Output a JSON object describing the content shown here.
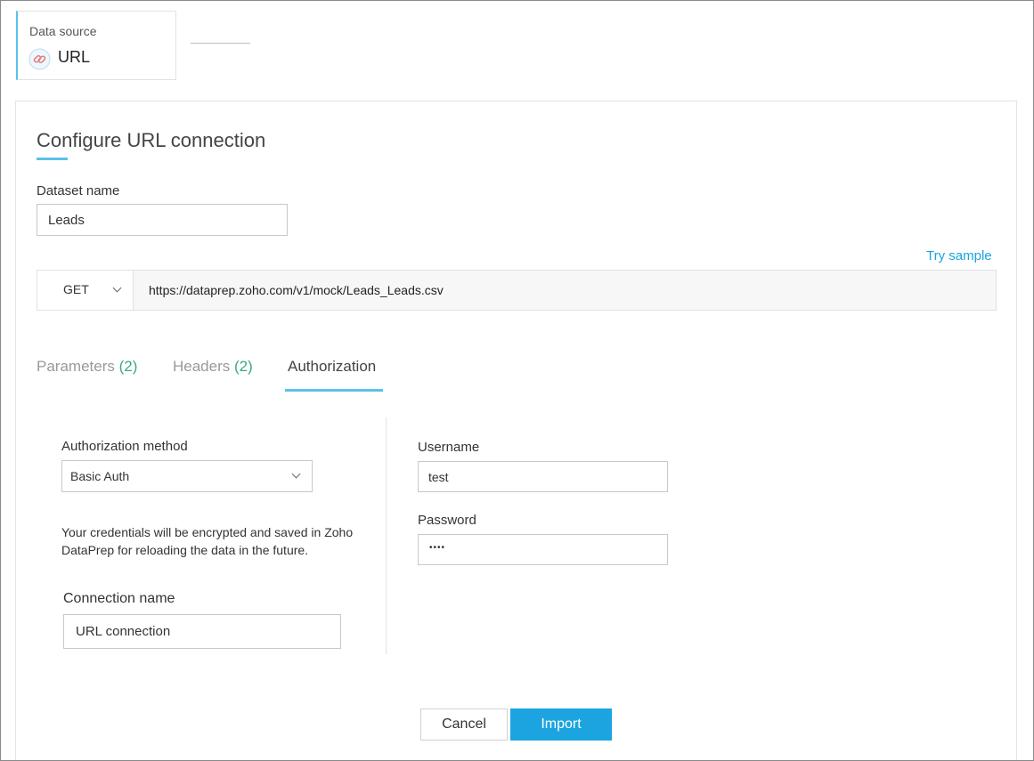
{
  "data_source": {
    "label": "Data source",
    "value": "URL",
    "icon": "link-icon"
  },
  "form": {
    "title": "Configure URL connection",
    "dataset_name_label": "Dataset name",
    "dataset_name_value": "Leads",
    "try_sample": "Try sample",
    "method": "GET",
    "url": "https://dataprep.zoho.com/v1/mock/Leads_Leads.csv"
  },
  "tabs": [
    {
      "label": "Parameters",
      "count": "(2)"
    },
    {
      "label": "Headers",
      "count": "(2)"
    },
    {
      "label": "Authorization",
      "count": ""
    }
  ],
  "auth": {
    "method_label": "Authorization method",
    "method_value": "Basic Auth",
    "note": "Your credentials will be encrypted and saved in Zoho DataPrep for reloading the data in the future.",
    "connection_name_label": "Connection name",
    "connection_name_value": "URL connection",
    "username_label": "Username",
    "username_value": "test",
    "password_label": "Password",
    "password_mask": "••••"
  },
  "buttons": {
    "cancel": "Cancel",
    "import": "Import"
  },
  "colors": {
    "accent": "#5bc0eb",
    "link": "#1aa3dd",
    "primary_button": "#1ca4e0",
    "count": "#3aa88c"
  }
}
